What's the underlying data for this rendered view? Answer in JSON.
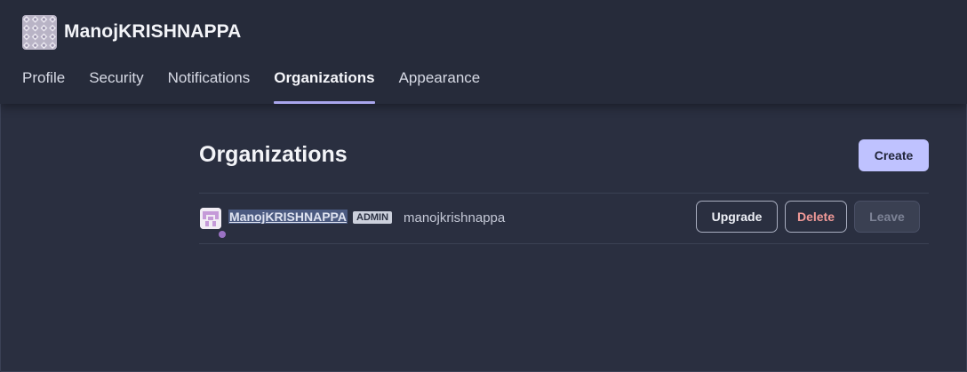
{
  "user": {
    "display_name": "ManojKRISHNAPPA",
    "avatar_icon": "user-identicon"
  },
  "tabs": [
    {
      "label": "Profile",
      "active": false
    },
    {
      "label": "Security",
      "active": false
    },
    {
      "label": "Notifications",
      "active": false
    },
    {
      "label": "Organizations",
      "active": true
    },
    {
      "label": "Appearance",
      "active": false
    }
  ],
  "main": {
    "title": "Organizations",
    "create_label": "Create",
    "organizations": [
      {
        "name": "ManojKRISHNAPPA",
        "role_badge": "ADMIN",
        "handle": "manojkrishnappa",
        "avatar_icon": "org-identicon",
        "actions": {
          "upgrade": "Upgrade",
          "delete": "Delete",
          "leave": "Leave"
        }
      }
    ]
  },
  "colors": {
    "background": "#2a2f40",
    "header_bg": "#262b3a",
    "accent": "#bfc2ff",
    "active_tab_underline": "#a9a6ec",
    "delete_text": "#f29a98",
    "status_dot": "#9a72c4"
  }
}
